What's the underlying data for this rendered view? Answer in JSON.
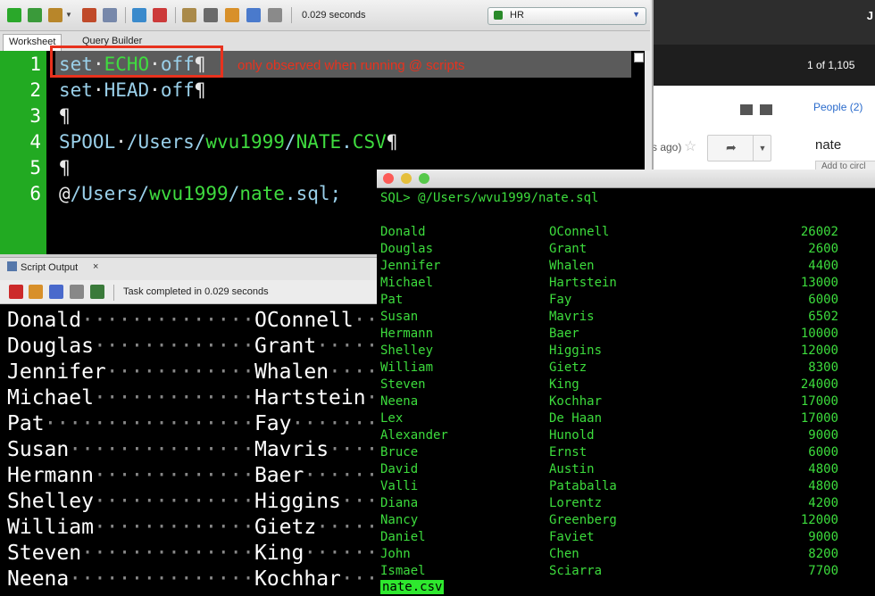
{
  "toolbar": {
    "elapsed": "0.029 seconds",
    "connection": "HR"
  },
  "tabs": [
    "Worksheet",
    "Query Builder"
  ],
  "editor": {
    "line_numbers": [
      "1",
      "2",
      "3",
      "4",
      "5",
      "6"
    ],
    "annotation": "only observed when running @ scripts"
  },
  "script_output": {
    "tab_label": "Script Output",
    "close": "×",
    "status": "Task completed in 0.029 seconds",
    "rows": [
      {
        "first": "Donald",
        "last": "OConnell"
      },
      {
        "first": "Douglas",
        "last": "Grant"
      },
      {
        "first": "Jennifer",
        "last": "Whalen"
      },
      {
        "first": "Michael",
        "last": "Hartstein"
      },
      {
        "first": "Pat",
        "last": "Fay"
      },
      {
        "first": "Susan",
        "last": "Mavris"
      },
      {
        "first": "Hermann",
        "last": "Baer"
      },
      {
        "first": "Shelley",
        "last": "Higgins"
      },
      {
        "first": "William",
        "last": "Gietz"
      },
      {
        "first": "Steven",
        "last": "King"
      },
      {
        "first": "Neena",
        "last": "Kochhar"
      }
    ]
  },
  "terminal": {
    "prompt": "SQL> @/Users/wvu1999/nate.sql",
    "rows": [
      [
        "Donald",
        "OConnell",
        "26002"
      ],
      [
        "Douglas",
        "Grant",
        "2600"
      ],
      [
        "Jennifer",
        "Whalen",
        "4400"
      ],
      [
        "Michael",
        "Hartstein",
        "13000"
      ],
      [
        "Pat",
        "Fay",
        "6000"
      ],
      [
        "Susan",
        "Mavris",
        "6502"
      ],
      [
        "Hermann",
        "Baer",
        "10000"
      ],
      [
        "Shelley",
        "Higgins",
        "12000"
      ],
      [
        "William",
        "Gietz",
        "8300"
      ],
      [
        "Steven",
        "King",
        "24000"
      ],
      [
        "Neena",
        "Kochhar",
        "17000"
      ],
      [
        "Lex",
        "De Haan",
        "17000"
      ],
      [
        "Alexander",
        "Hunold",
        "9000"
      ],
      [
        "Bruce",
        "Ernst",
        "6000"
      ],
      [
        "David",
        "Austin",
        "4800"
      ],
      [
        "Valli",
        "Pataballa",
        "4800"
      ],
      [
        "Diana",
        "Lorentz",
        "4200"
      ],
      [
        "Nancy",
        "Greenberg",
        "12000"
      ],
      [
        "Daniel",
        "Faviet",
        "9000"
      ],
      [
        "John",
        "Chen",
        "8200"
      ],
      [
        "Ismael",
        "Sciarra",
        "7700"
      ]
    ],
    "last_command": "nate.csv"
  },
  "background": {
    "user_initial": "J",
    "pager": "1 of 1,105",
    "people_link": "People (2)",
    "contact": "nate",
    "time_ago": "s ago)",
    "add_to_circles": "Add to circl"
  }
}
